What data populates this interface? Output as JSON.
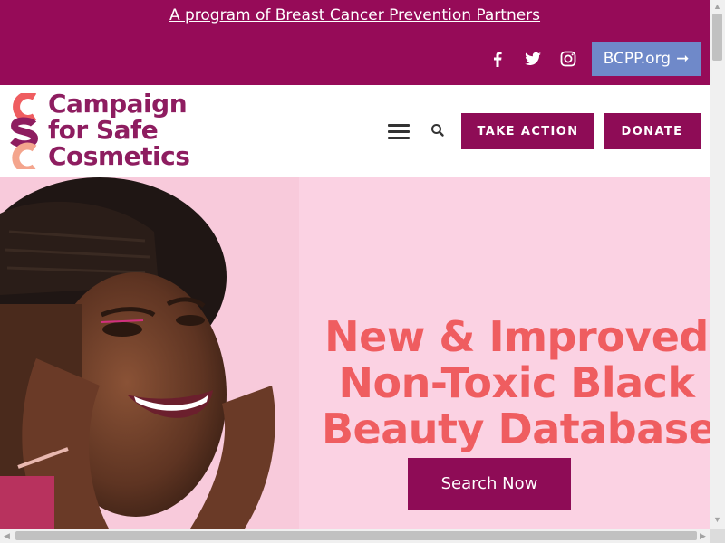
{
  "topbar": {
    "program_link": "A program of Breast Cancer Prevention Partners",
    "social": [
      "facebook-icon",
      "twitter-icon",
      "instagram-icon"
    ],
    "bcpp_button": "BCPP.org",
    "bcpp_arrow": "➞",
    "background": "#960b58"
  },
  "header": {
    "logo_letters": [
      "C",
      "S",
      "C"
    ],
    "logo_lines": [
      "Campaign",
      "for Safe",
      "Cosmetics"
    ],
    "menu_icon": "hamburger-icon",
    "search_icon": "search-icon",
    "take_action": "TAKE ACTION",
    "donate": "DONATE",
    "accent": "#8e0c56"
  },
  "hero": {
    "title_lines": [
      "New & Improved",
      "Non-Toxic Black",
      "Beauty Database"
    ],
    "button": "Search Now",
    "title_color": "#ef5d60",
    "background": "#fbd2e3"
  }
}
